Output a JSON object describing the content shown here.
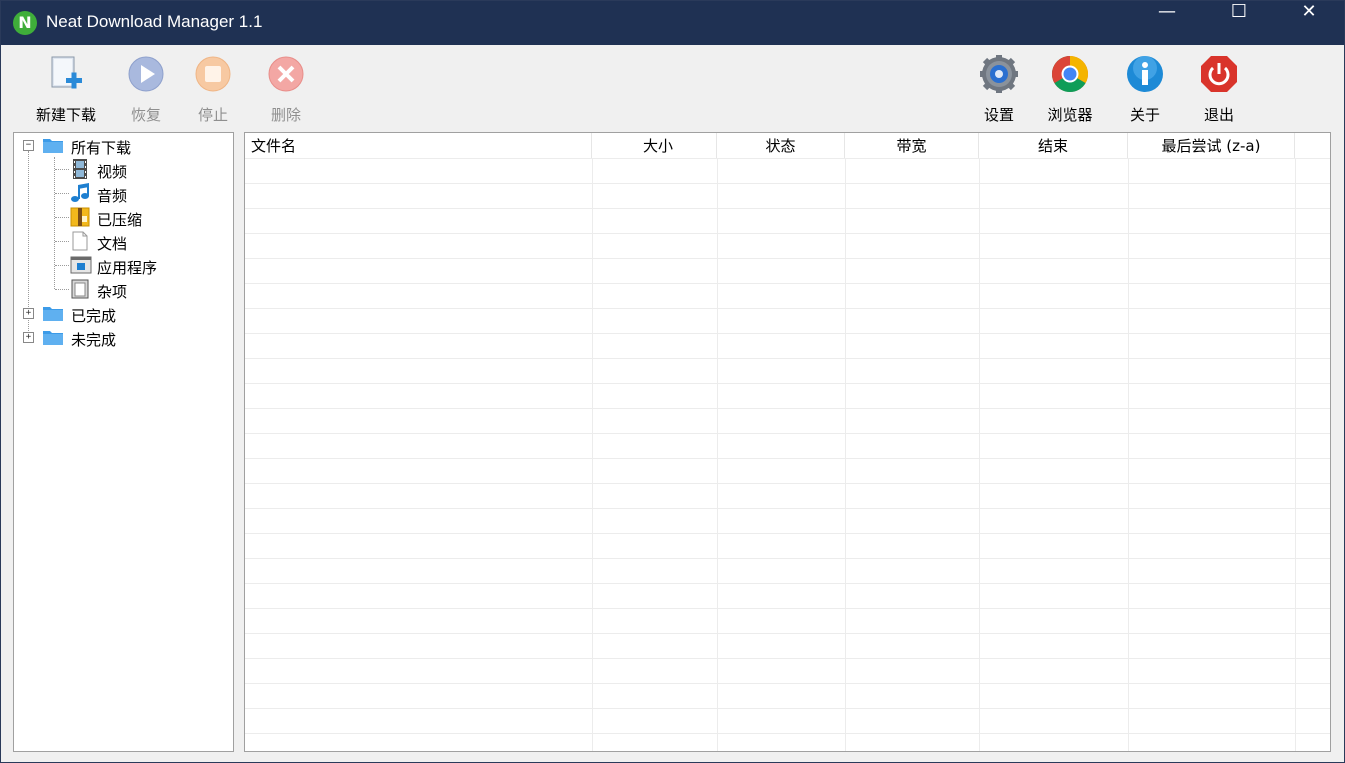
{
  "window": {
    "title": "Neat Download Manager 1.1",
    "app_icon_letter": "N"
  },
  "titlebar": {
    "minimize": "—",
    "maximize": "☐",
    "close": "✕"
  },
  "toolbar": {
    "new_download": "新建下载",
    "resume": "恢复",
    "stop": "停止",
    "delete": "删除",
    "settings": "设置",
    "browser": "浏览器",
    "about": "关于",
    "exit": "退出"
  },
  "tree": {
    "all_downloads": "所有下载",
    "video": "视频",
    "audio": "音频",
    "compressed": "已压缩",
    "documents": "文档",
    "applications": "应用程序",
    "misc": "杂项",
    "completed": "已完成",
    "incomplete": "未完成"
  },
  "list": {
    "columns": [
      "文件名",
      "大小",
      "状态",
      "带宽",
      "结束",
      "最后尝试 (z-a)"
    ]
  },
  "colors": {
    "titlebar": "#1f3153",
    "folder": "#3c9be8",
    "accent_blue": "#2a8ad8",
    "exit_red": "#d9342b"
  }
}
